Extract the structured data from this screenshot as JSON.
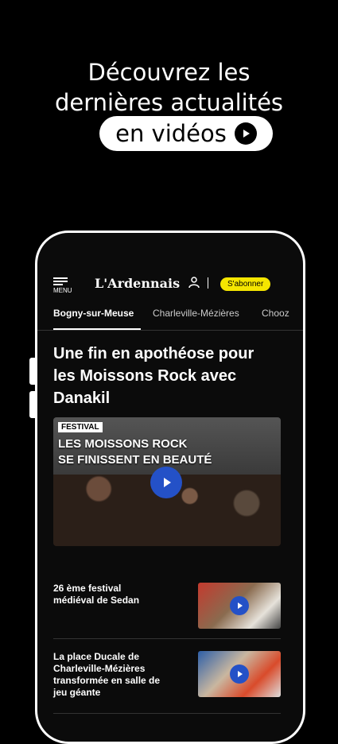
{
  "promo": {
    "line1": "Découvrez les",
    "line2": "dernières actualités",
    "pill": "en vidéos",
    "pill_icon": "play-circle-icon"
  },
  "app": {
    "menu_label": "MENU",
    "logo": "L'Ardennais",
    "subscribe": "S'abonner",
    "accent": "#f5e600"
  },
  "tabs": [
    "Bogny-sur-Meuse",
    "Charleville-Mézières",
    "Chooz"
  ],
  "article": {
    "title": "Une fin en apothéose pour les Moissons Rock avec Danakil",
    "video_tag": "FESTIVAL",
    "video_line1": "LES MOISSONS ROCK",
    "video_line2": "SE FINISSENT EN BEAUTÉ"
  },
  "list": [
    {
      "title": "26 ème festival médiéval de Sedan"
    },
    {
      "title": "La place Ducale de Charleville-Mézières transformée en salle de jeu géante"
    }
  ]
}
